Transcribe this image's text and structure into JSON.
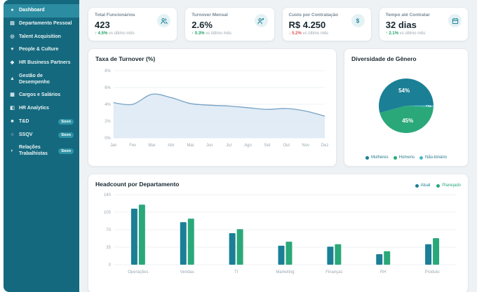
{
  "colors": {
    "sidebar_bg": "#15697e",
    "sidebar_active_bg": "#2c8da2",
    "teal": "#1b7f96",
    "green": "#2aa87a",
    "light_teal": "#49b8c9",
    "delta_up": "#1fa36a",
    "delta_down": "#e25555",
    "line": "#78a2c4",
    "line_fill": "#dce9f4"
  },
  "sidebar": {
    "items": [
      {
        "label": "Dashboard",
        "icon": "dashboard-icon",
        "glyph": "●",
        "active": true
      },
      {
        "label": "Departamento Pessoal",
        "icon": "people-icon",
        "glyph": "▤"
      },
      {
        "label": "Talent Acquisition",
        "icon": "talent-icon",
        "glyph": "◎"
      },
      {
        "label": "People & Culture",
        "icon": "culture-heart-icon",
        "glyph": "♥"
      },
      {
        "label": "HR Business Partners",
        "icon": "partners-icon",
        "glyph": "◆"
      },
      {
        "label": "Gestão de Desempenho",
        "icon": "performance-icon",
        "glyph": "▲"
      },
      {
        "label": "Cargos e Salários",
        "icon": "salary-icon",
        "glyph": "▦"
      },
      {
        "label": "HR Analytics",
        "icon": "analytics-icon",
        "glyph": "◧"
      },
      {
        "label": "T&D",
        "icon": "training-icon",
        "glyph": "■",
        "badge": "Soon"
      },
      {
        "label": "SSQV",
        "icon": "wellbeing-icon",
        "glyph": "○",
        "badge": "Soon"
      },
      {
        "label": "Relações Trabalhistas",
        "icon": "relations-icon",
        "glyph": "◐",
        "badge": "Soon"
      }
    ]
  },
  "kpis": [
    {
      "title": "Total Funcionários",
      "value": "423",
      "direction": "up",
      "delta": "4.5%",
      "note": "vs último mês",
      "icon": "users-icon"
    },
    {
      "title": "Turnover Mensal",
      "value": "2.6%",
      "direction": "up",
      "delta": "0.3%",
      "note": "vs último mês",
      "icon": "user-trend-icon"
    },
    {
      "title": "Custo por Contratação",
      "value": "R$ 4.250",
      "direction": "down",
      "delta": "5.2%",
      "note": "vs último mês",
      "icon": "dollar-icon"
    },
    {
      "title": "Tempo até Contratar",
      "value": "32 dias",
      "direction": "up",
      "delta": "2.1%",
      "note": "vs último mês",
      "icon": "calendar-icon"
    }
  ],
  "chart_data": [
    {
      "type": "area",
      "title": "Taxa de Turnover (%)",
      "x": [
        "Jan",
        "Fev",
        "Mar",
        "Abr",
        "Mai",
        "Jun",
        "Jul",
        "Ago",
        "Set",
        "Out",
        "Nov",
        "Dez"
      ],
      "values": [
        4.2,
        4.0,
        5.2,
        4.8,
        4.1,
        3.9,
        3.8,
        3.6,
        3.4,
        3.5,
        3.2,
        2.6
      ],
      "ylim": [
        0,
        8
      ],
      "yticks": [
        0,
        2,
        4,
        6,
        8
      ],
      "ytick_labels": [
        "0%",
        "2%",
        "4%",
        "6%",
        "8%"
      ],
      "line_color": "#78a2c4",
      "fill_color": "#dce9f4",
      "grid": true
    },
    {
      "type": "pie",
      "title": "Diversidade de Gênero",
      "slices": [
        {
          "label": "Mulheres",
          "value": 54,
          "color": "#1b7f96"
        },
        {
          "label": "Homens",
          "value": 45,
          "color": "#2aa87a"
        },
        {
          "label": "Não-binário",
          "value": 1,
          "color": "#49b8c9"
        }
      ],
      "start_angle": 255,
      "draw_order": [
        0,
        2,
        1
      ],
      "legend_position": "bottom"
    },
    {
      "type": "bar",
      "title": "Headcount por Departamento",
      "categories": [
        "Operações",
        "Vendas",
        "TI",
        "Marketing",
        "Finanças",
        "RH",
        "Produto"
      ],
      "series": [
        {
          "name": "Atual",
          "color": "#1b7f96",
          "values": [
            112,
            85,
            63,
            38,
            36,
            21,
            41
          ]
        },
        {
          "name": "Planejado",
          "color": "#2aa87a",
          "values": [
            120,
            92,
            71,
            46,
            41,
            27,
            53
          ]
        }
      ],
      "ylim": [
        0,
        140
      ],
      "yticks": [
        0,
        35,
        70,
        105,
        140
      ],
      "legend_position": "top-right",
      "grid": true
    }
  ]
}
